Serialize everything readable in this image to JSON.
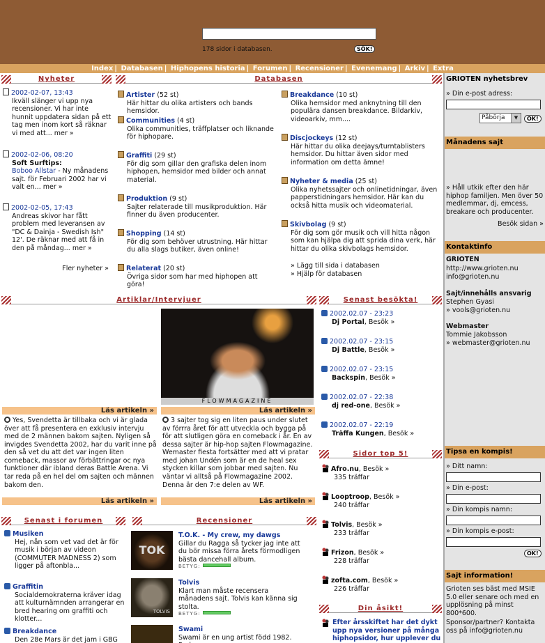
{
  "header": {
    "search_count": "178 sidor i databasen.",
    "search_button": "SÖK!"
  },
  "nav": [
    "Index",
    "Databasen",
    "Hiphopens historia",
    "Forumen",
    "Recensioner",
    "Evenemang",
    "Arkiv",
    "Extra"
  ],
  "nyheter": {
    "title": "Nyheter",
    "items": [
      {
        "date": "2002-02-07, 13:43",
        "text": "Ikväll slänger vi upp nya recensioner. Vi har inte hunnit uppdatera sidan på ett tag men inom kort så räknar vi med att... mer »"
      },
      {
        "date": "2002-02-06, 08:20",
        "heading": "Soft Surftips:",
        "link": "Boboo Allstar",
        "text": " - Ny månadens sajt. för Februari 2002 har vi valt en... mer »"
      },
      {
        "date": "2002-02-05, 17:43",
        "text": "Andreas skivor har fått problem med leveransen av \"DC & Dainja - Swedish Ish\" 12'. De räknar med att få in den på måndag... mer »"
      }
    ],
    "more": "Fler nyheter »"
  },
  "databasen": {
    "title": "Databasen",
    "left": [
      {
        "name": "Artister",
        "count": "(52 st)",
        "desc": "Här hittar du olika artisters och bands hemsidor."
      },
      {
        "name": "Communities",
        "count": "(4 st)",
        "desc": "Olika communities, träffplatser och liknande för hiphopare."
      },
      {
        "name": "Graffiti",
        "count": "(29 st)",
        "desc": "För dig som gillar den grafiska delen inom hiphopen, hemsidor med bilder och annat material."
      },
      {
        "name": "Produktion",
        "count": "(9 st)",
        "desc": "Sajter relaterade till musikproduktion. Här finner du även producenter."
      },
      {
        "name": "Shopping",
        "count": "(14 st)",
        "desc": "För dig som behöver utrustning. Här hittar du alla slags butiker, även online!"
      },
      {
        "name": "Relaterat",
        "count": "(20 st)",
        "desc": "Övriga sidor som har med hiphopen att göra!"
      }
    ],
    "right": [
      {
        "name": "Breakdance",
        "count": "(10 st)",
        "desc": "Olika hemsidor med anknytning till den populära dansen breakdance. Bildarkiv, videoarkiv, mm...."
      },
      {
        "name": "Discjockeys",
        "count": "(12 st)",
        "desc": "Här hittar du olika deejays/turntablisters hemsidor. Du hittar även sidor med information om detta ämne!"
      },
      {
        "name": "Nyheter & media",
        "count": "(25 st)",
        "desc": "Olika nyhetssajter och onlinetidningar, även papperstidningars hemsidor. Här kan du också hitta musik och videomaterial."
      },
      {
        "name": "Skivbolag",
        "count": "(9 st)",
        "desc": "För dig som gör musik och vill hitta någon som kan hjälpa dig att sprida dina verk, här hittar du olika skivbolags hemsidor."
      }
    ],
    "links": [
      "» Lägg till sida i databasen",
      "» Hjälp för databasen"
    ]
  },
  "artiklar": {
    "title": "Artiklar/Intervjuer",
    "photo_caption": "FLOWMAGAZINE",
    "read": "Läs artikeln »",
    "text1": "Yes, Svendetta är tillbaka och vi är glada över att få presentera en exklusiv intervju med de 2 männen bakom sajten. Nyligen så invigdes Svendetta 2002, har du varit inne på den så vet du att det var ingen liten comeback, massor av förbättringar oc nya funktioner där ibland deras Battle Arena. Vi tar reda på en hel del om sajten och männen bakom den.",
    "text2": "3 sajter tog sig en liten paus under slutet av förrra året för att utveckla och bygga på för att slutligen göra en comeback i år. En av dessa sajter är hip-hop sajten Flowmagazine. Wemaster fiesta fortsätter med att vi pratar med johan Undén som är en de heal sex stycken killar som jobbar med sajten. Nu väntar vi alltså på Flowmagazine 2002. Denna är den 7:e delen av WF."
  },
  "besokta": {
    "title": "Senast besökta!",
    "items": [
      {
        "date": "2002.02.07 - 23:23",
        "name": "Dj Portal"
      },
      {
        "date": "2002.02.07 - 23:15",
        "name": "Dj Battle"
      },
      {
        "date": "2002.02.07 - 23:15",
        "name": "Backspin"
      },
      {
        "date": "2002.02.07 - 22:38",
        "name": "dj red-one"
      },
      {
        "date": "2002.02.07 - 22:19",
        "name": "Träffa Kungen"
      }
    ],
    "visit": ", Besök »"
  },
  "top5": {
    "title": "Sidor top 5!",
    "items": [
      {
        "name": "Afro.nu",
        "hits": "335 träffar"
      },
      {
        "name": "Looptroop",
        "hits": "240 träffar"
      },
      {
        "name": "Tolvis",
        "hits": "233 träffar"
      },
      {
        "name": "Frizon",
        "hits": "228 träffar"
      },
      {
        "name": "zofta.com",
        "hits": "226 träffar"
      }
    ]
  },
  "asikt": {
    "title": "Din åsikt!",
    "question": "Efter årsskiftet har det dykt upp nya versioner på många hiphopsidor, hur upplever du"
  },
  "forumen": {
    "title": "Senast i forumen",
    "items": [
      {
        "name": "Musiken",
        "text": "Hej, nån som vet vad det är för musik i början av videon (COMMUTER MADNESS 2) som ligger på aftonbla..."
      },
      {
        "name": "Graffitin",
        "text": "Socialdemokraterna kräver idag att kulturnämnden arrangerar en bred hearing om graffiti och klotter..."
      },
      {
        "name": "Breakdance",
        "text": "Den 28e Mars är det jam i GBG med"
      }
    ]
  },
  "recensioner": {
    "title": "Recensioner",
    "betyg": "BETYG:",
    "items": [
      {
        "name": "T.O.K. - My crew, my dawgs",
        "text": "Gillar du Ragga så tycker jag inte att du bör missa förra årets förmodligen bästa dancehall album.",
        "cover": "TOK"
      },
      {
        "name": "Tolvis",
        "text": "Klart man måste recensera månadens sajt. Tolvis kan känna sig stolta.",
        "cover": "TOLVIS"
      },
      {
        "name": "Swami",
        "text": "Swami är en ung artist född 1982. Redan",
        "cover": ""
      }
    ]
  },
  "right": {
    "nyhetsbrev": "GRIOTEN nyhetsbrev",
    "email_label": "» Din e-post adress:",
    "select": "Påbörja",
    "ok": "OK!",
    "manadens": "Månadens sajt",
    "manadens_text": "» Håll utkik efter den här hiphop familjen. Men över 50 medlemmar, dj, emcess, breakare och producenter.",
    "manadens_visit": "Besök sidan »",
    "kontakt": "Kontaktinfo",
    "kontakt_name": "GRIOTEN",
    "kontakt_url": "http://www.grioten.nu",
    "kontakt_mail": "info@grioten.nu",
    "ansvarig_title": "Sajt/innehålls ansvarig",
    "ansvarig_name": "Stephen Gyasi",
    "ansvarig_mail": "» vools@grioten.nu",
    "webmaster_title": "Webmaster",
    "webmaster_name": "Tommie Jakobsson",
    "webmaster_mail": "» webmaster@grioten.nu",
    "tipsa": "Tipsa en kompis!",
    "tipsa_fields": [
      "» Ditt namn:",
      "» Din e-post:",
      "» Din kompis namn:",
      "» Din kompis e-post:"
    ],
    "info_title": "Sajt information!",
    "info_text": "Grioten ses bäst med MSIE 5.0 eller senare och med en upplösning på minst 800*600.",
    "sponsor": "Sponsor/partner? Kontakta oss på info@grioten.nu"
  }
}
